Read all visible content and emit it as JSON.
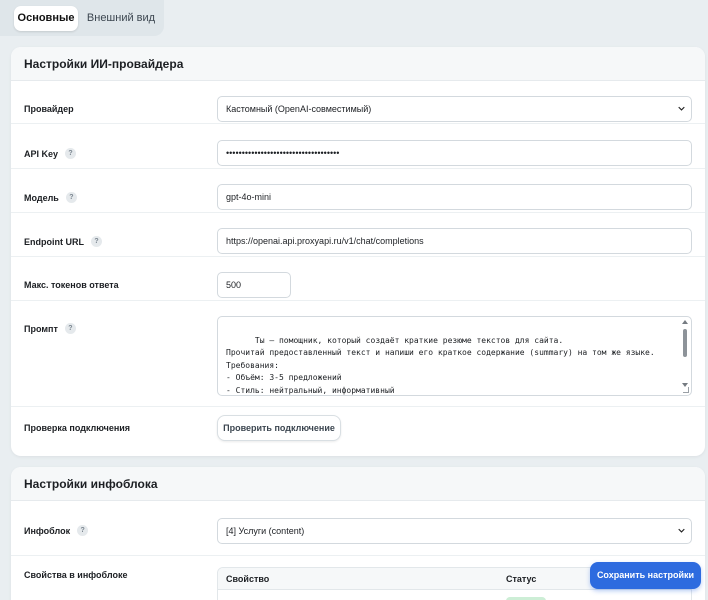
{
  "tabs": [
    {
      "label": "Основные",
      "active": true
    },
    {
      "label": "Внешний вид",
      "active": false
    }
  ],
  "ai_section": {
    "title": "Настройки ИИ-провайдера",
    "provider": {
      "label": "Провайдер",
      "value": "Кастомный (OpenAI-совместимый)"
    },
    "api_key": {
      "label": "API Key",
      "value": "••••••••••••••••••••••••••••••••••••"
    },
    "model": {
      "label": "Модель",
      "value": "gpt-4o-mini"
    },
    "endpoint": {
      "label": "Endpoint URL",
      "value": "https://openai.api.proxyapi.ru/v1/chat/completions"
    },
    "max_tokens": {
      "label": "Макс. токенов ответа",
      "value": "500"
    },
    "prompt": {
      "label": "Промпт",
      "value": "Ты — помощник, который создаёт краткие резюме текстов для сайта.\nПрочитай предоставленный текст и напиши его краткое содержание (summary) на том же языке.\nТребования:\n- Объём: 3-5 предложений\n- Стиль: нейтральный, информативный\n- Без вводных фраз типа «В данном тексте...» или «Автор рассказывает...»"
    },
    "connection": {
      "label": "Проверка подключения",
      "button": "Проверить подключение"
    }
  },
  "iblock_section": {
    "title": "Настройки инфоблока",
    "iblock": {
      "label": "Инфоблок",
      "value": "[4] Услуги (content)"
    },
    "properties": {
      "label": "Свойства в инфоблоке",
      "columns": [
        "Свойство",
        "Статус"
      ]
    }
  },
  "help_glyph": "?",
  "save_button": "Сохранить настройки",
  "colors": {
    "accent": "#2d6bdf",
    "background": "#e9eef1",
    "status_ok": "#cdeed6"
  }
}
